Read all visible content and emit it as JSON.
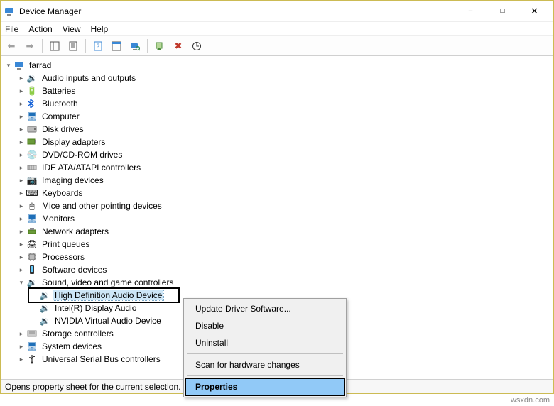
{
  "window": {
    "title": "Device Manager"
  },
  "menubar": {
    "file": "File",
    "action": "Action",
    "view": "View",
    "help": "Help"
  },
  "tree": {
    "root": "farrad",
    "nodes": {
      "audio_io": "Audio inputs and outputs",
      "batteries": "Batteries",
      "bluetooth": "Bluetooth",
      "computer": "Computer",
      "disk": "Disk drives",
      "display": "Display adapters",
      "dvd": "DVD/CD-ROM drives",
      "ide": "IDE ATA/ATAPI controllers",
      "imaging": "Imaging devices",
      "keyboards": "Keyboards",
      "mice": "Mice and other pointing devices",
      "monitors": "Monitors",
      "network": "Network adapters",
      "printq": "Print queues",
      "processors": "Processors",
      "software": "Software devices",
      "svg": "Sound, video and game controllers",
      "svg_children": {
        "hdad": "High Definition Audio Device",
        "intel": "Intel(R) Display Audio",
        "nvidia": "NVIDIA Virtual Audio Device"
      },
      "storage": "Storage controllers",
      "system": "System devices",
      "usb": "Universal Serial Bus controllers"
    }
  },
  "context_menu": {
    "update": "Update Driver Software...",
    "disable": "Disable",
    "uninstall": "Uninstall",
    "scan": "Scan for hardware changes",
    "properties": "Properties"
  },
  "statusbar": {
    "text": "Opens property sheet for the current selection."
  },
  "watermark": "wsxdn.com"
}
